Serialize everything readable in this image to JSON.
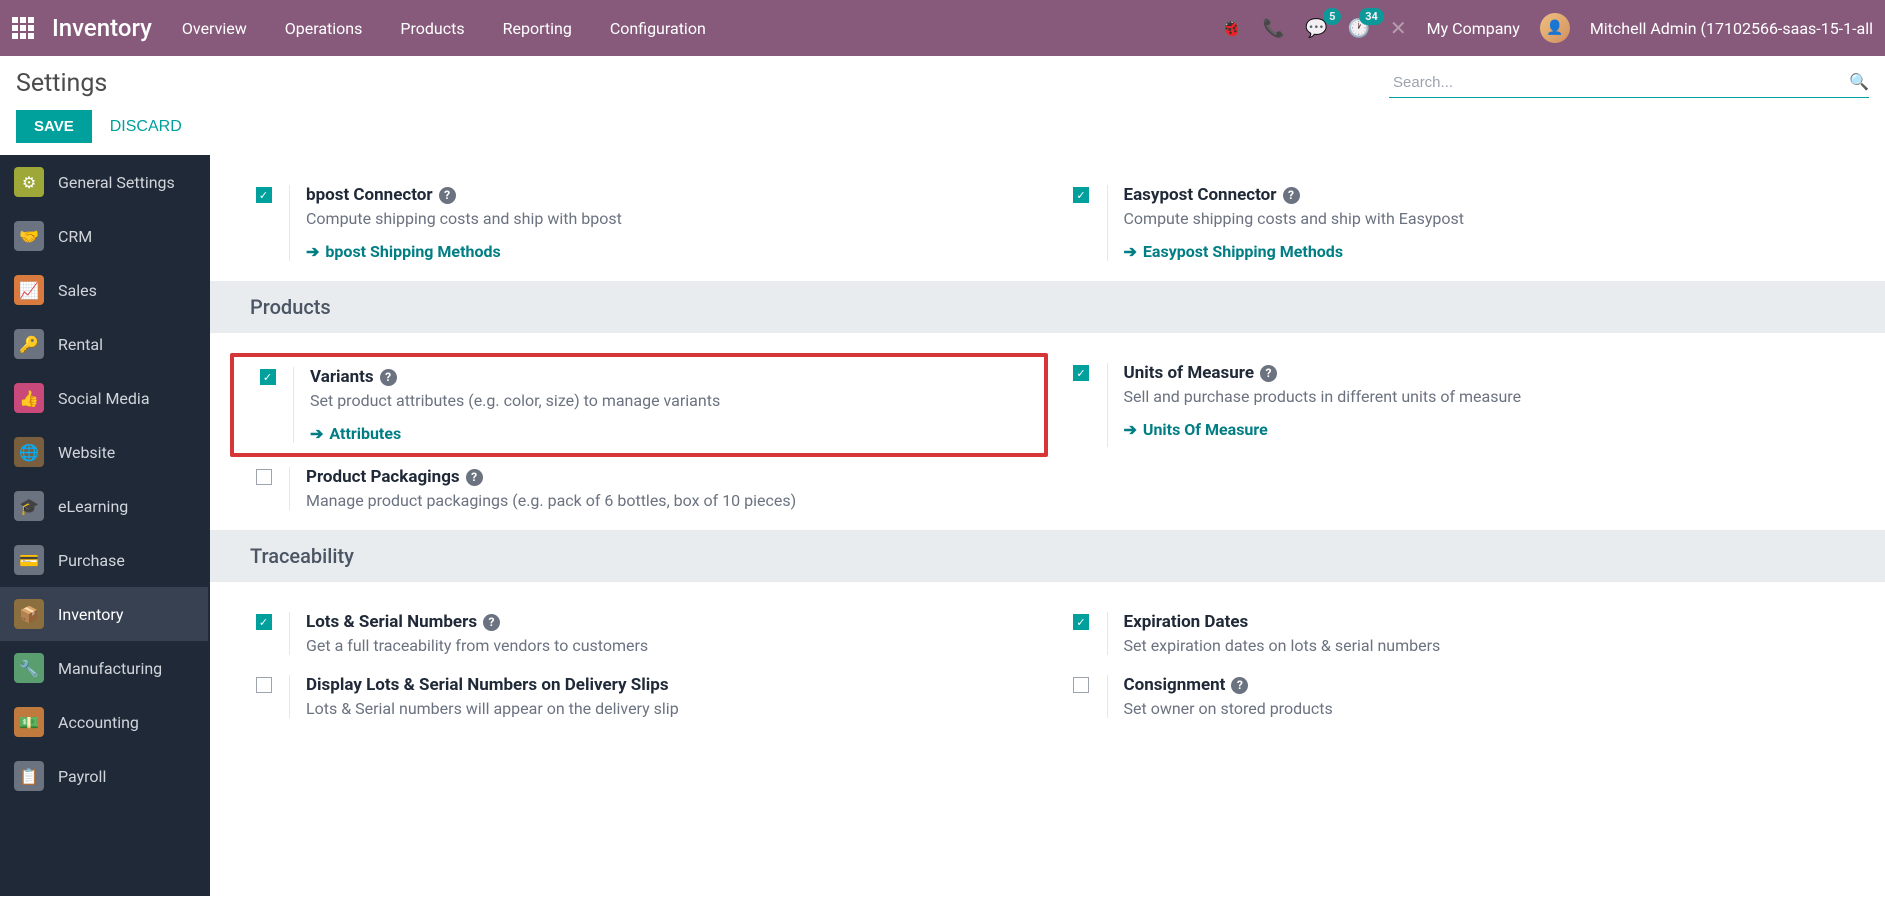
{
  "navbar": {
    "brand": "Inventory",
    "items": [
      "Overview",
      "Operations",
      "Products",
      "Reporting",
      "Configuration"
    ],
    "badge_messages": "5",
    "badge_activities": "34",
    "company": "My Company",
    "username": "Mitchell Admin (17102566-saas-15-1-all"
  },
  "header": {
    "title": "Settings",
    "search_placeholder": "Search..."
  },
  "actions": {
    "save": "SAVE",
    "discard": "DISCARD"
  },
  "sidebar": [
    {
      "label": "General Settings",
      "icon": "⚙",
      "cls": "ic-general"
    },
    {
      "label": "CRM",
      "icon": "🤝",
      "cls": "ic-crm"
    },
    {
      "label": "Sales",
      "icon": "📈",
      "cls": "ic-sales"
    },
    {
      "label": "Rental",
      "icon": "🔑",
      "cls": "ic-rental"
    },
    {
      "label": "Social Media",
      "icon": "👍",
      "cls": "ic-social"
    },
    {
      "label": "Website",
      "icon": "🌐",
      "cls": "ic-website"
    },
    {
      "label": "eLearning",
      "icon": "🎓",
      "cls": "ic-elearning"
    },
    {
      "label": "Purchase",
      "icon": "💳",
      "cls": "ic-purchase"
    },
    {
      "label": "Inventory",
      "icon": "📦",
      "cls": "ic-inventory"
    },
    {
      "label": "Manufacturing",
      "icon": "🔧",
      "cls": "ic-manufacturing"
    },
    {
      "label": "Accounting",
      "icon": "💵",
      "cls": "ic-accounting"
    },
    {
      "label": "Payroll",
      "icon": "📋",
      "cls": "ic-payroll"
    }
  ],
  "sections": {
    "shipping": [
      {
        "title": "bpost Connector",
        "desc": "Compute shipping costs and ship with bpost",
        "link": "bpost Shipping Methods",
        "checked": true,
        "help": true
      },
      {
        "title": "Easypost Connector",
        "desc": "Compute shipping costs and ship with Easypost",
        "link": "Easypost Shipping Methods",
        "checked": true,
        "help": true
      }
    ],
    "products_header": "Products",
    "products": [
      {
        "title": "Variants",
        "desc": "Set product attributes (e.g. color, size) to manage variants",
        "link": "Attributes",
        "checked": true,
        "help": true,
        "highlight": true
      },
      {
        "title": "Units of Measure",
        "desc": "Sell and purchase products in different units of measure",
        "link": "Units Of Measure",
        "checked": true,
        "help": true
      },
      {
        "title": "Product Packagings",
        "desc": "Manage product packagings (e.g. pack of 6 bottles, box of 10 pieces)",
        "checked": false,
        "help": true
      }
    ],
    "traceability_header": "Traceability",
    "traceability": [
      {
        "title": "Lots & Serial Numbers",
        "desc": "Get a full traceability from vendors to customers",
        "checked": true,
        "help": true
      },
      {
        "title": "Expiration Dates",
        "desc": "Set expiration dates on lots & serial numbers",
        "checked": true,
        "help": false
      },
      {
        "title": "Display Lots & Serial Numbers on Delivery Slips",
        "desc": "Lots & Serial numbers will appear on the delivery slip",
        "checked": false,
        "help": false
      },
      {
        "title": "Consignment",
        "desc": "Set owner on stored products",
        "checked": false,
        "help": true
      }
    ]
  }
}
